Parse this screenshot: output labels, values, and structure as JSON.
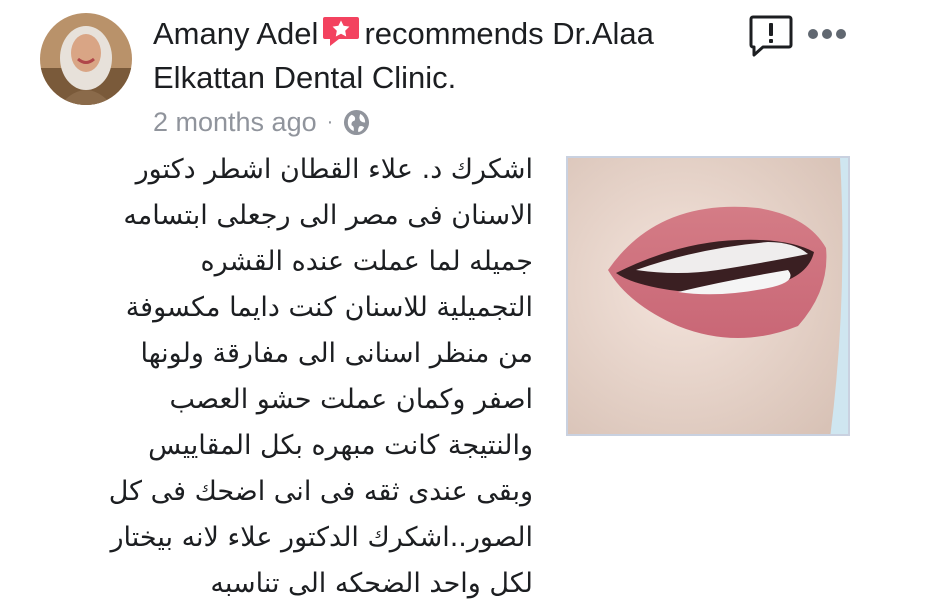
{
  "post": {
    "author": "Amany Adel",
    "action": "recommends",
    "page_name": "Dr.Alaa Elkattan Dental Clinic.",
    "timestamp": "2 months ago",
    "separator": "·",
    "privacy_icon": "globe-icon",
    "recommend_icon": "recommend-badge-icon",
    "report_icon": "report-icon",
    "more_icon": "more-options-icon",
    "body_lines": [
      "اشكرك د. علاء القطان اشطر دكتور",
      "الاسنان فى مصر الى رجعلى ابتسامه",
      "جميله لما عملت عنده القشره",
      "التجميلية للاسنان كنت دايما مكسوفة",
      "من منظر اسنانى الى مفارقة ولونها",
      "اصفر وكمان عملت حشو العصب",
      "والنتيجة كانت مبهره بكل المقاييس",
      "وبقى عندى ثقه فى انى اضحك فى كل",
      "الصور..اشكرك الدكتور علاء لانه بيختار",
      "لكل واحد الضحكه الى تناسبه"
    ]
  },
  "colors": {
    "text_primary": "#1c1e21",
    "text_secondary": "#90949c",
    "recommend_badge": "#f3425f",
    "photo_border": "#c9d1e0"
  }
}
